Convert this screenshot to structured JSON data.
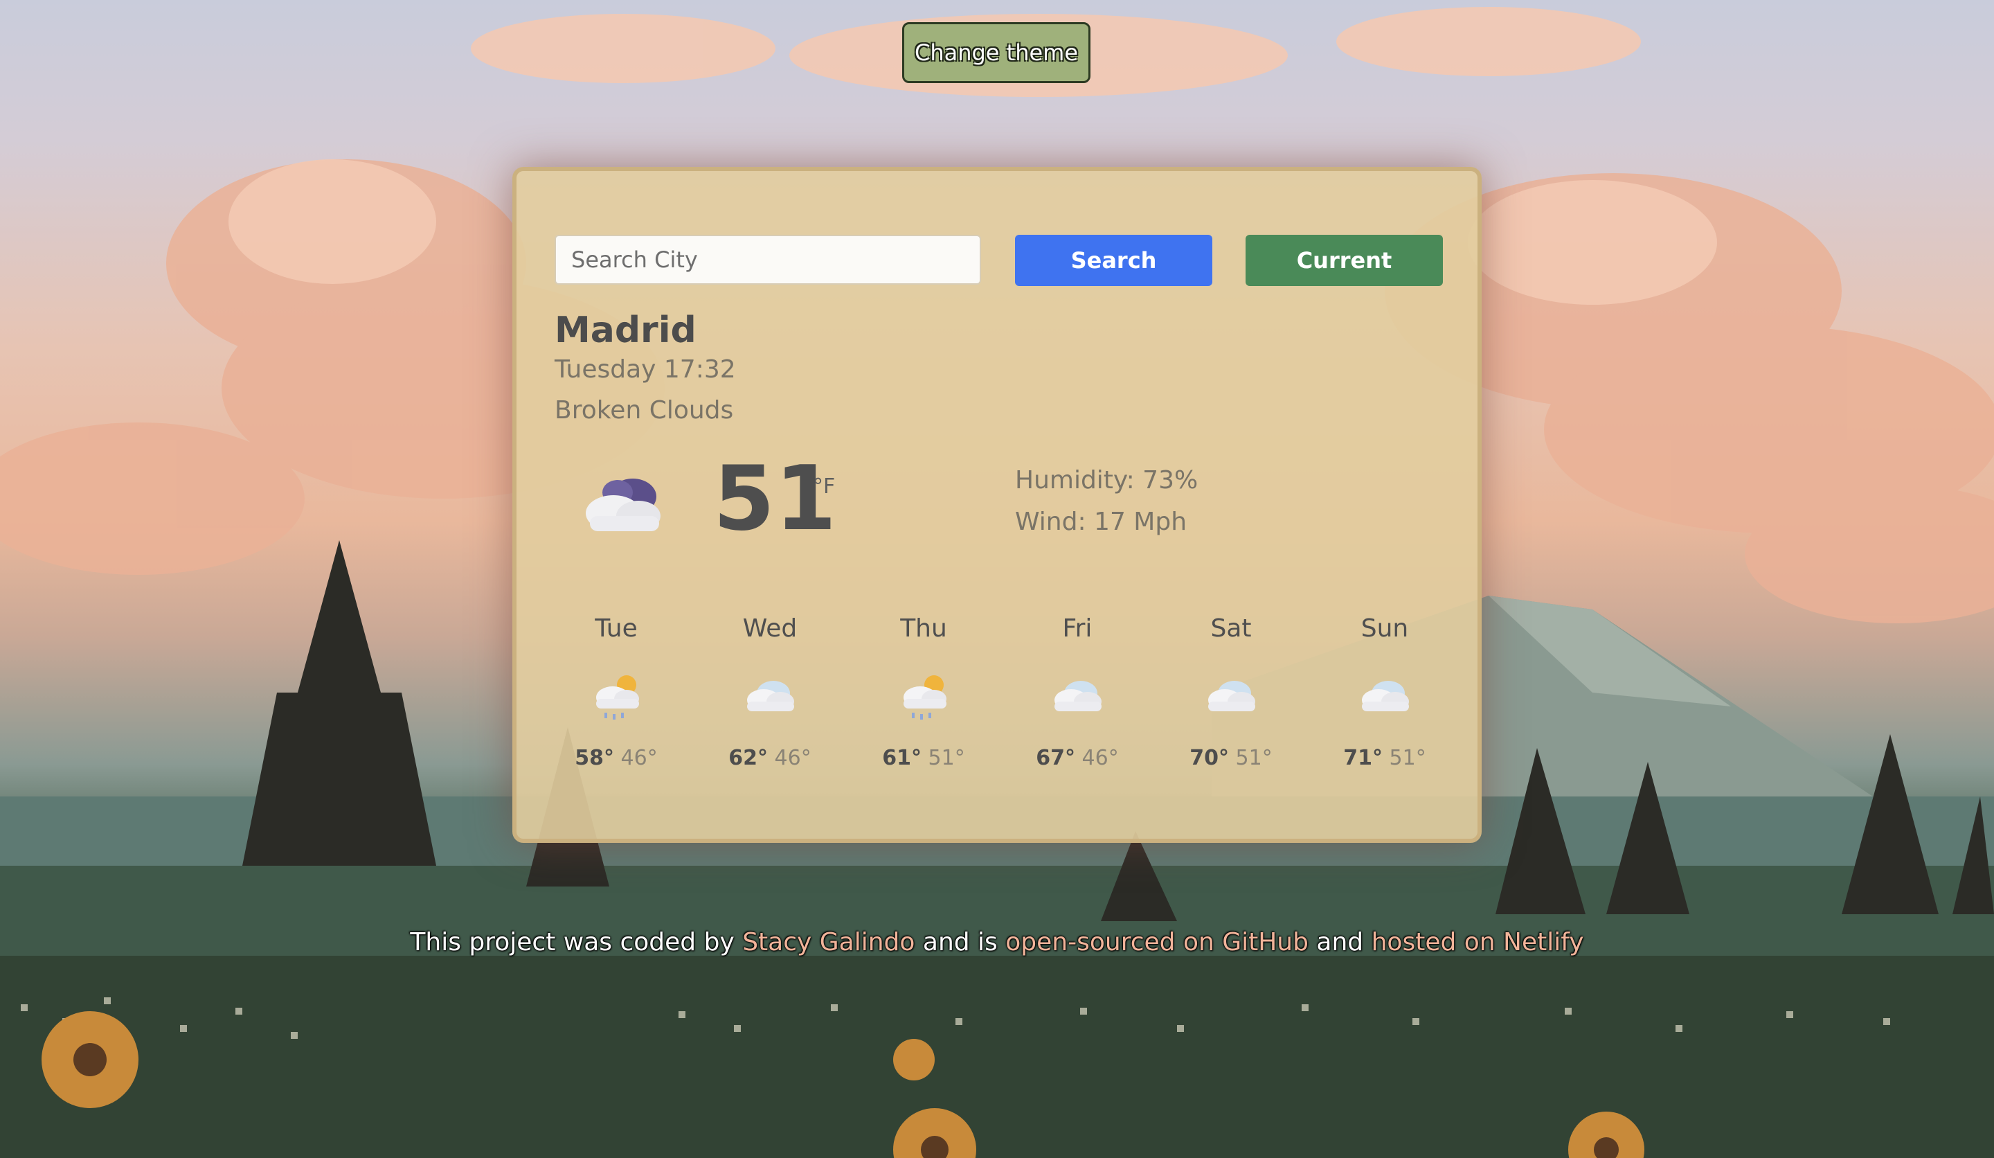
{
  "theme_button": {
    "label": "Change theme"
  },
  "search": {
    "placeholder": "Search City",
    "value": "",
    "search_label": "Search",
    "current_label": "Current"
  },
  "weather": {
    "city": "Madrid",
    "datetime": "Tuesday 17:32",
    "description": "Broken Clouds",
    "icon": "broken-clouds-icon",
    "temperature": "51",
    "unit": "°F",
    "humidity": "Humidity: 73%",
    "wind": "Wind: 17 Mph"
  },
  "forecast": [
    {
      "day": "Tue",
      "icon": "sun-rain-cloud-icon",
      "high": "58°",
      "low": "46°"
    },
    {
      "day": "Wed",
      "icon": "cloud-icon",
      "high": "62°",
      "low": "46°"
    },
    {
      "day": "Thu",
      "icon": "sun-rain-cloud-icon",
      "high": "61°",
      "low": "51°"
    },
    {
      "day": "Fri",
      "icon": "cloud-icon",
      "high": "67°",
      "low": "46°"
    },
    {
      "day": "Sat",
      "icon": "cloud-icon",
      "high": "70°",
      "low": "51°"
    },
    {
      "day": "Sun",
      "icon": "cloud-icon",
      "high": "71°",
      "low": "51°"
    }
  ],
  "footer": {
    "text1": "This project was coded by ",
    "author": "Stacy Galindo",
    "text2": " and is ",
    "github_link": "open-sourced on GitHub",
    "text3": " and ",
    "netlify_link": "hosted on Netlify"
  },
  "colors": {
    "theme_button": "#9fb17b",
    "search_button": "#3f73f0",
    "current_button": "#4a8a58",
    "card": "#e2cd9e",
    "footer_link": "#f2b49a"
  }
}
